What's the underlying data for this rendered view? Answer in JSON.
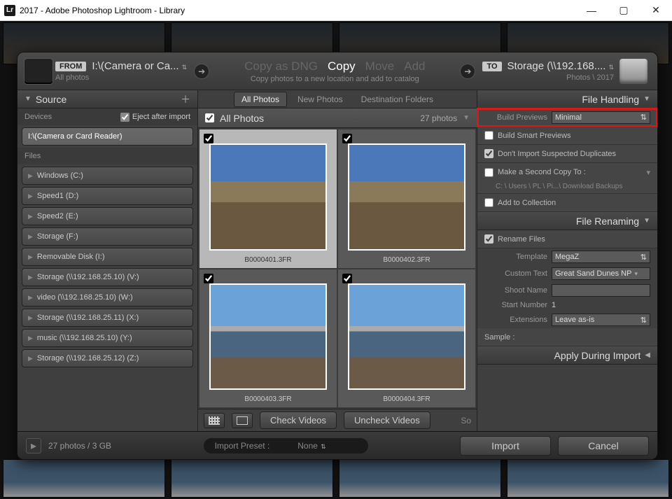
{
  "window": {
    "title": "2017 - Adobe Photoshop Lightroom - Library",
    "icon_text": "Lr"
  },
  "header": {
    "from_badge": "FROM",
    "from_path": "I:\\(Camera or Ca...",
    "from_sub": "All photos",
    "actions": {
      "dng": "Copy as DNG",
      "copy": "Copy",
      "move": "Move",
      "add": "Add"
    },
    "center_sub": "Copy photos to a new location and add to catalog",
    "to_badge": "TO",
    "to_path": "Storage (\\\\192.168....",
    "to_sub": "Photos \\ 2017"
  },
  "source": {
    "title": "Source",
    "devices_label": "Devices",
    "eject_label": "Eject after import",
    "active_device": "I:\\(Camera or Card Reader)",
    "files_label": "Files",
    "drives": [
      "Windows (C:)",
      "Speed1 (D:)",
      "Speed2 (E:)",
      "Storage (F:)",
      "Removable Disk (I:)",
      "Storage (\\\\192.168.25.10) (V:)",
      "video (\\\\192.168.25.10) (W:)",
      "Storage (\\\\192.168.25.11) (X:)",
      "music (\\\\192.168.25.10) (Y:)",
      "Storage (\\\\192.168.25.12) (Z:)"
    ]
  },
  "center": {
    "tabs": {
      "all": "All Photos",
      "new": "New Photos",
      "dest": "Destination Folders"
    },
    "head": "All Photos",
    "count": "27 photos",
    "thumbs": [
      {
        "name": "B0000401.3FR",
        "kind": "trees",
        "sel": true
      },
      {
        "name": "B0000402.3FR",
        "kind": "trees",
        "sel": false
      },
      {
        "name": "B0000403.3FR",
        "kind": "dunes",
        "sel": false
      },
      {
        "name": "B0000404.3FR",
        "kind": "dunes",
        "sel": false
      }
    ],
    "check_videos": "Check Videos",
    "uncheck_videos": "Uncheck Videos",
    "sort_label": "So"
  },
  "right": {
    "file_handling": "File Handling",
    "build_previews_label": "Build Previews",
    "build_previews_value": "Minimal",
    "smart_previews": "Build Smart Previews",
    "dont_import_dup": "Don't Import Suspected Duplicates",
    "second_copy": "Make a Second Copy To :",
    "second_copy_path": "C: \\ Users \\ PL \\ Pi...\\ Download Backups",
    "add_collection": "Add to Collection",
    "file_renaming": "File Renaming",
    "rename_files": "Rename Files",
    "template_label": "Template",
    "template_value": "MegaZ",
    "custom_text_label": "Custom Text",
    "custom_text_value": "Great Sand Dunes NP",
    "shoot_name_label": "Shoot Name",
    "start_number_label": "Start Number",
    "start_number_value": "1",
    "extensions_label": "Extensions",
    "extensions_value": "Leave as-is",
    "sample_label": "Sample :",
    "apply_during": "Apply During Import"
  },
  "footer": {
    "status": "27 photos / 3 GB",
    "preset_label": "Import Preset :",
    "preset_value": "None",
    "import": "Import",
    "cancel": "Cancel"
  }
}
